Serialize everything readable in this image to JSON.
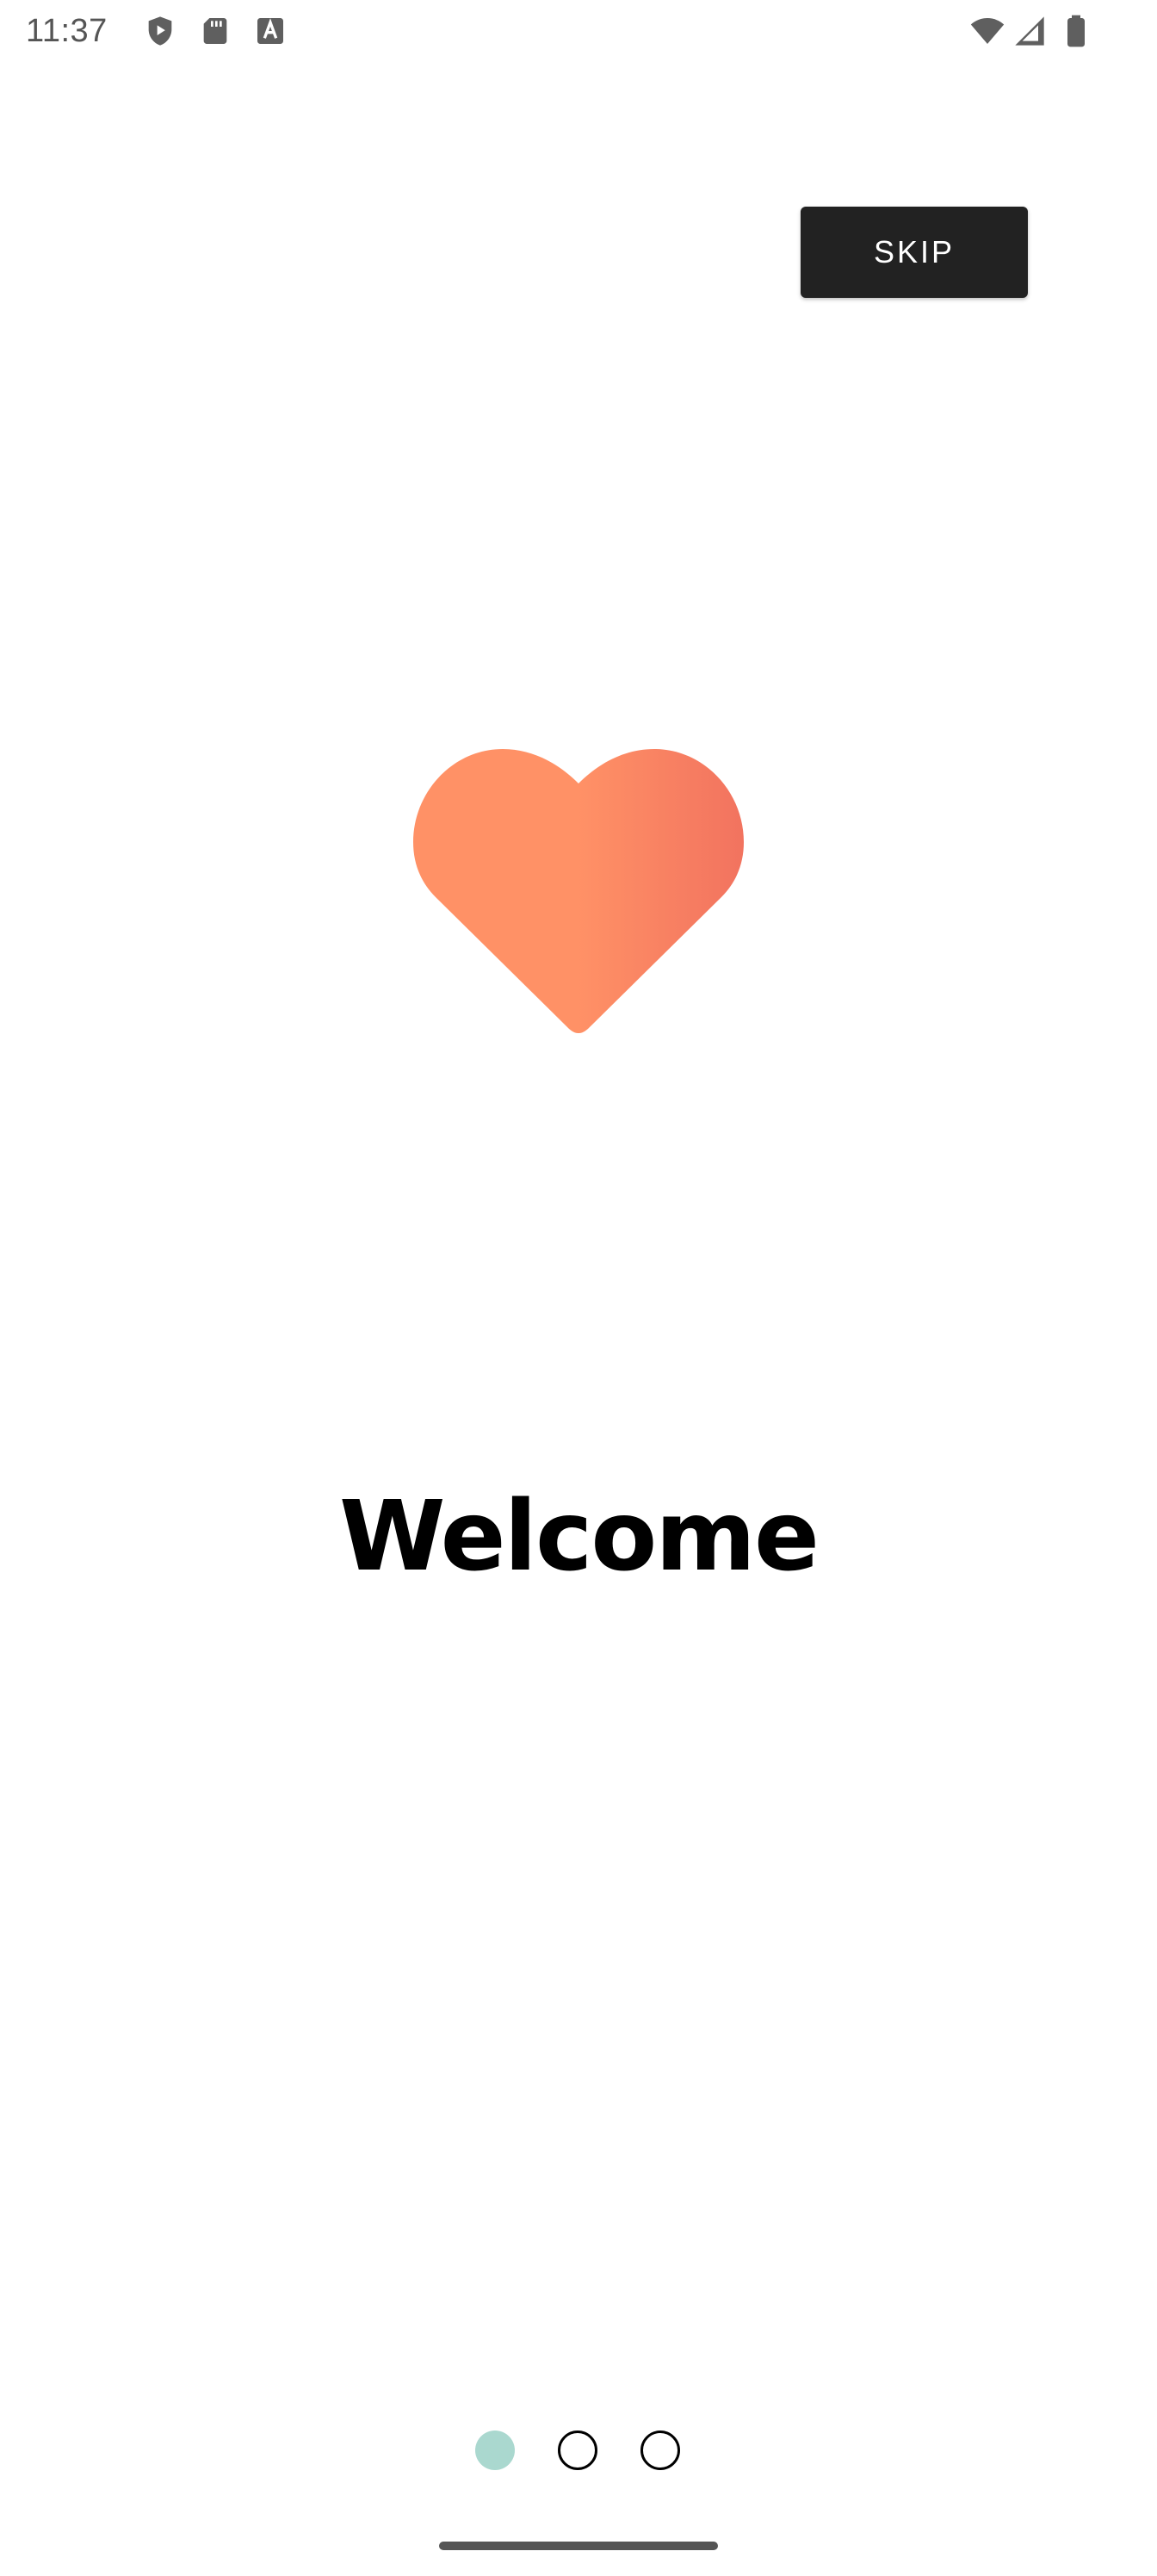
{
  "status_bar": {
    "time": "11:37",
    "left_icons": [
      "shield-play-icon",
      "sd-card-icon",
      "font-a-icon"
    ],
    "right_icons": [
      "wifi-icon",
      "signal-icon",
      "battery-icon"
    ]
  },
  "skip_button": {
    "label": "SKIP"
  },
  "hero": {
    "icon": "heart-icon",
    "gradient_start": "#ff9166",
    "gradient_end": "#f2735f"
  },
  "title": "Welcome",
  "pager": {
    "total_pages": 3,
    "current_page": 1,
    "active_color": "#aad8cf"
  }
}
